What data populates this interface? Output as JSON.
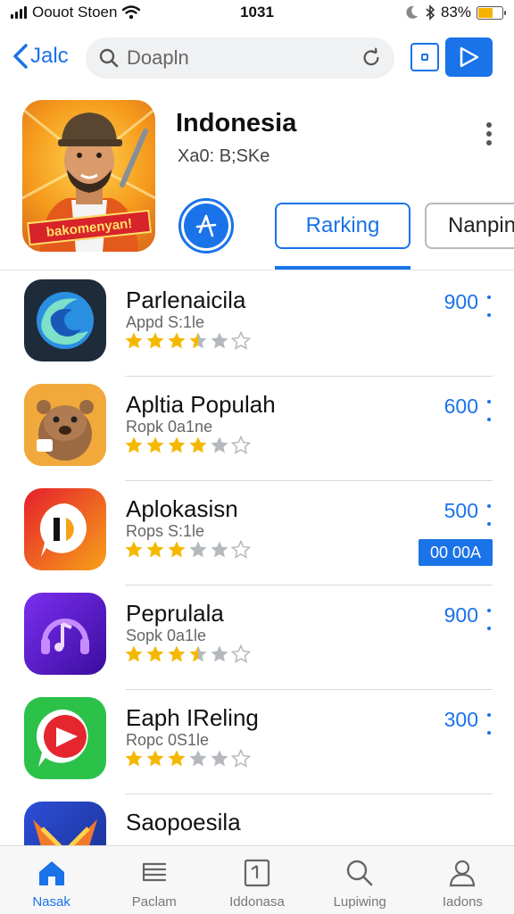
{
  "status_bar": {
    "carrier": "Oouot Stoen",
    "time": "1031",
    "battery": "83%",
    "battery_level": 0.6
  },
  "nav": {
    "back_label": "Jalc",
    "search_placeholder": "Doapln"
  },
  "header": {
    "title": "Indonesia",
    "subtitle": "Xa0: B;SKe",
    "hero_banner": "bakomenyan!"
  },
  "tabs": {
    "ranking": "Rarking",
    "second": "Nanpinc"
  },
  "apps": [
    {
      "name": "Parlenaicila",
      "sub": "Appd S:1le",
      "count": "900",
      "stars": [
        1,
        1,
        1,
        0.5,
        0,
        0
      ],
      "icon": "swirl-icon"
    },
    {
      "name": "Apltia Populah",
      "sub": "Ropk 0a1ne",
      "count": "600",
      "stars": [
        1,
        1,
        1,
        1,
        0,
        0
      ],
      "icon": "beaver-icon"
    },
    {
      "name": "Aplokasisn",
      "sub": "Rops S:1le",
      "count": "500",
      "stars": [
        1,
        1,
        1,
        0,
        0,
        0
      ],
      "icon": "chat-bubble-icon"
    },
    {
      "name": "Peprulala",
      "sub": "Sopk 0a1le",
      "count": "900",
      "stars": [
        1,
        1,
        1,
        0.5,
        0,
        0
      ],
      "icon": "music-icon"
    },
    {
      "name": "Eaph IReling",
      "sub": "Ropc 0S1le",
      "count": "300",
      "stars": [
        1,
        1,
        1,
        0,
        0,
        0
      ],
      "icon": "play-icon"
    },
    {
      "name": "Saopoesila",
      "sub": "",
      "count": "",
      "stars": [],
      "icon": "bird-icon",
      "badge": "00 00A"
    }
  ],
  "tab_bar": [
    {
      "label": "Nasak",
      "icon": "home-icon",
      "active": true
    },
    {
      "label": "Paclam",
      "icon": "list-icon",
      "active": false
    },
    {
      "label": "Iddonasa",
      "icon": "frame-icon",
      "active": false
    },
    {
      "label": "Lupiwing",
      "icon": "search-icon",
      "active": false
    },
    {
      "label": "Iadons",
      "icon": "person-icon",
      "active": false
    }
  ],
  "colors": {
    "accent": "#1a73e8",
    "star": "#f5b800",
    "star_empty": "#b5b8bd"
  }
}
